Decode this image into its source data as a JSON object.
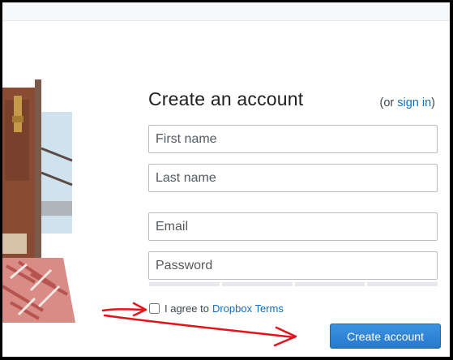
{
  "form": {
    "title": "Create an account",
    "signin_prefix": "(or ",
    "signin_link": "sign in",
    "signin_suffix": ")",
    "first_name_placeholder": "First name",
    "last_name_placeholder": "Last name",
    "email_placeholder": "Email",
    "password_placeholder": "Password",
    "agree_text": "I agree to",
    "terms_link": "Dropbox Terms",
    "agree_checked": false,
    "submit_label": "Create account"
  },
  "colors": {
    "link": "#0f6fbf",
    "button": "#2f86d8",
    "annotation_arrow": "#e0141b"
  },
  "icons": [
    "door-illustration",
    "arrow-annotation"
  ]
}
